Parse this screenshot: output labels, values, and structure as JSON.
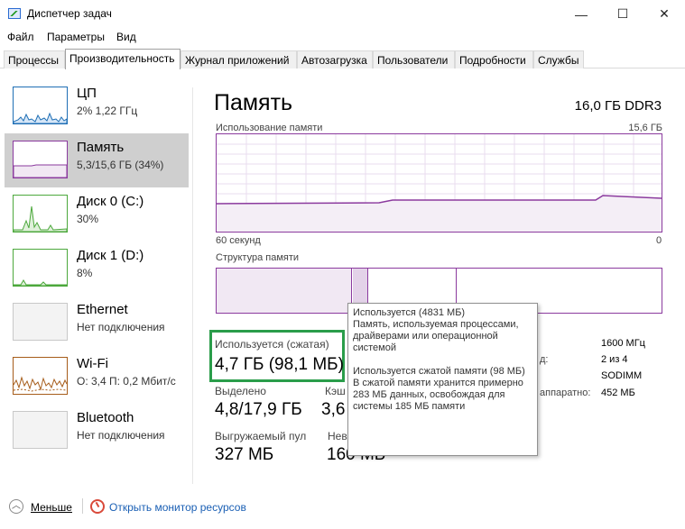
{
  "window": {
    "title": "Диспетчер задач",
    "minimize": "—",
    "maximize": "☐",
    "close": "✕"
  },
  "menu": [
    "Файл",
    "Параметры",
    "Вид"
  ],
  "tabs": [
    "Процессы",
    "Производительность",
    "Журнал приложений",
    "Автозагрузка",
    "Пользователи",
    "Подробности",
    "Службы"
  ],
  "sidebar": [
    {
      "name": "ЦП",
      "sub": "2% 1,22 ГГц"
    },
    {
      "name": "Память",
      "sub": "5,3/15,6 ГБ (34%)"
    },
    {
      "name": "Диск 0 (C:)",
      "sub": "30%"
    },
    {
      "name": "Диск 1 (D:)",
      "sub": "8%"
    },
    {
      "name": "Ethernet",
      "sub": "Нет подключения"
    },
    {
      "name": "Wi-Fi",
      "sub": "О: 3,4 П: 0,2 Мбит/с"
    },
    {
      "name": "Bluetooth",
      "sub": "Нет подключения"
    }
  ],
  "main": {
    "title": "Память",
    "capacity": "16,0 ГБ DDR3",
    "usage_label": "Использование памяти",
    "usage_max": "15,6 ГБ",
    "time_left": "60 секунд",
    "time_right": "0",
    "composition_label": "Структура памяти"
  },
  "stats": {
    "in_use_label": "Используется (сжатая)",
    "in_use_value": "4,7 ГБ (98,1 МБ)",
    "committed_label": "Выделено",
    "committed_value": "4,8/17,9 ГБ",
    "cached_label": "Кэш",
    "cached_value": "3,6",
    "paged_label": "Выгружаемый пул",
    "paged_value": "327 МБ",
    "nonpaged_label": "Нев",
    "nonpaged_value": "160 МБ"
  },
  "right_panel": {
    "speed_value": "1600 МГц",
    "slots_label": "д:",
    "slots_value": "2 из 4",
    "form_value": "SODIMM",
    "reserved_label": "аппаратно:",
    "reserved_value": "452 МБ"
  },
  "tooltip": {
    "p1_title": "Используется (4831 МБ)",
    "p1_body": "Память, используемая процессами, драйверами или операционной системой",
    "p2_title": "Используется сжатой памяти (98 МБ)",
    "p2_body": "В сжатой памяти хранится примерно 283 МБ данных, освобождая для системы 185 МБ памяти"
  },
  "bottom": {
    "fewer_label": "Меньше",
    "monitor_label": "Открыть монитор ресурсов"
  },
  "colors": {
    "memory": "#8b3a9e",
    "cpu": "#1f6fb5",
    "disk": "#4ca83c",
    "wifi": "#a65c1a",
    "highlight": "#2a9d4a"
  }
}
